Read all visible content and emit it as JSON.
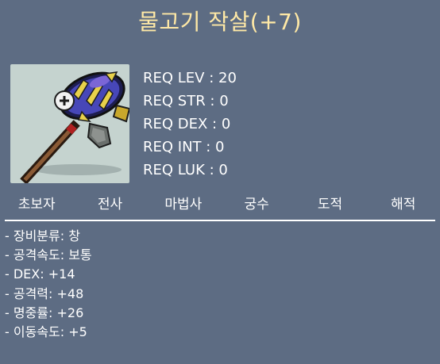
{
  "item": {
    "name": "물고기 작살(+7)",
    "icon": "fish-harpoon-icon"
  },
  "requirements": [
    "REQ LEV : 20",
    "REQ STR : 0",
    "REQ DEX : 0",
    "REQ INT : 0",
    "REQ LUK : 0"
  ],
  "jobs": [
    "초보자",
    "전사",
    "마법사",
    "궁수",
    "도적",
    "해적"
  ],
  "stats": [
    "- 장비분류: 창",
    "- 공격속도: 보통",
    "- DEX: +14",
    "- 공격력: +48",
    "- 명중률: +26",
    "- 이동속도: +5"
  ],
  "colors": {
    "background": "#5d6c83",
    "title": "#ffe9a6",
    "text": "#ffffff",
    "icon_bg": "#c5d3cf"
  }
}
